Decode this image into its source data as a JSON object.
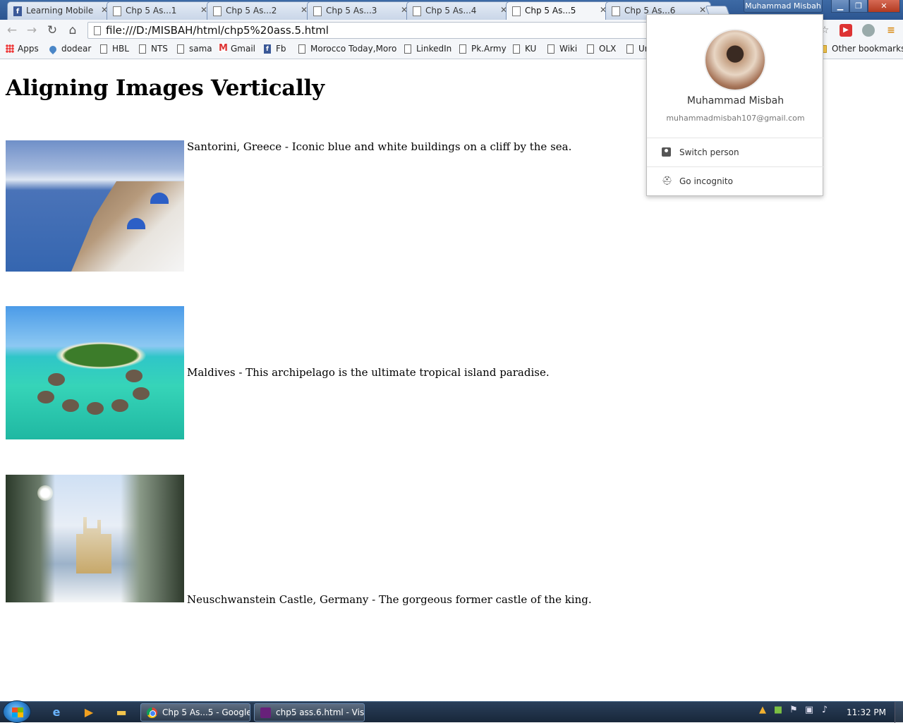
{
  "window": {
    "tabs": [
      {
        "title": "Learning Mobile",
        "icon": "facebook-icon"
      },
      {
        "title": "Chp 5 As...1",
        "icon": "page-icon"
      },
      {
        "title": "Chp 5 As...2",
        "icon": "page-icon"
      },
      {
        "title": "Chp 5 As...3",
        "icon": "page-icon"
      },
      {
        "title": "Chp 5 As...4",
        "icon": "page-icon"
      },
      {
        "title": "Chp 5 As...5",
        "icon": "page-icon",
        "active": true
      },
      {
        "title": "Chp 5 As...6",
        "icon": "page-icon"
      }
    ],
    "profile_button": "Muhammad Misbah",
    "controls": {
      "minimize": "▁",
      "maximize": "❐",
      "close": "✕"
    }
  },
  "toolbar": {
    "back": "←",
    "forward": "→",
    "reload": "↻",
    "home": "⌂",
    "url": "file:///D:/MISBAH/html/chp5%20ass.5.html",
    "star": "☆",
    "menu": "≡"
  },
  "bookmarks": {
    "items": [
      {
        "label": "Apps",
        "icon": "apps-icon"
      },
      {
        "label": "dodear",
        "icon": "drop-icon"
      },
      {
        "label": "HBL",
        "icon": "page-icon"
      },
      {
        "label": "NTS",
        "icon": "page-icon"
      },
      {
        "label": "sama",
        "icon": "page-icon"
      },
      {
        "label": "Gmail",
        "icon": "gmail-icon"
      },
      {
        "label": "Fb",
        "icon": "facebook-icon"
      },
      {
        "label": "Morocco Today,Moro",
        "icon": "page-icon"
      },
      {
        "label": "LinkedIn",
        "icon": "page-icon"
      },
      {
        "label": "Pk.Army",
        "icon": "page-icon"
      },
      {
        "label": "KU",
        "icon": "page-icon"
      },
      {
        "label": "Wiki",
        "icon": "page-icon"
      },
      {
        "label": "OLX",
        "icon": "page-icon"
      },
      {
        "label": "Ur",
        "icon": "page-icon"
      }
    ],
    "other": "Other bookmarks"
  },
  "page": {
    "heading": "Aligning Images Vertically",
    "entries": [
      {
        "caption": "Santorini, Greece - Iconic blue and white buildings on a cliff by the sea."
      },
      {
        "caption": "Maldives - This archipelago is the ultimate tropical island paradise."
      },
      {
        "caption": "Neuschwanstein Castle, Germany - The gorgeous former castle of the king."
      }
    ]
  },
  "profile_menu": {
    "name": "Muhammad Misbah",
    "email": "muhammadmisbah107@gmail.com",
    "items": [
      {
        "label": "Switch person",
        "icon": "person-icon"
      },
      {
        "label": "Go incognito",
        "icon": "incognito-icon"
      }
    ]
  },
  "taskbar": {
    "tasks": [
      {
        "label": "Chp 5 As...5 - Google...",
        "icon": "chrome-icon"
      },
      {
        "label": "chp5 ass.6.html - Vis...",
        "icon": "vscode-icon"
      }
    ],
    "clock": "11:32 PM"
  }
}
